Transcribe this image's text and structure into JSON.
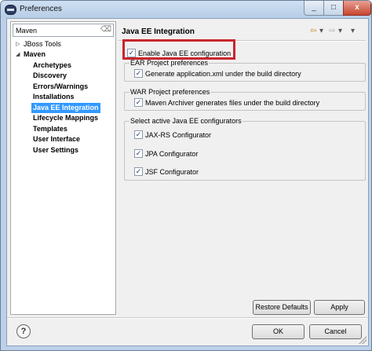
{
  "window": {
    "title": "Preferences",
    "close_glyph": "x",
    "min_glyph": "_",
    "max_glyph": "□"
  },
  "filter": {
    "value": "Maven"
  },
  "tree": [
    {
      "label": "JBoss Tools",
      "expanded": false,
      "bold": false,
      "selected": false
    },
    {
      "label": "Maven",
      "expanded": true,
      "bold": true,
      "selected": false
    },
    {
      "label": "Archetypes",
      "bold": true,
      "selected": false
    },
    {
      "label": "Discovery",
      "bold": true,
      "selected": false
    },
    {
      "label": "Errors/Warnings",
      "bold": true,
      "selected": false
    },
    {
      "label": "Installations",
      "bold": true,
      "selected": false
    },
    {
      "label": "Java EE Integration",
      "bold": true,
      "selected": true
    },
    {
      "label": "Lifecycle Mappings",
      "bold": true,
      "selected": false
    },
    {
      "label": "Templates",
      "bold": true,
      "selected": false
    },
    {
      "label": "User Interface",
      "bold": true,
      "selected": false
    },
    {
      "label": "User Settings",
      "bold": true,
      "selected": false
    }
  ],
  "page": {
    "title": "Java EE Integration",
    "nav": {
      "back_glyph": "⇦",
      "fwd_glyph": "⇨",
      "menu_glyph": "▾"
    },
    "enable": {
      "label": "Enable Java EE configuration",
      "checked": true
    },
    "ear": {
      "title": "EAR Project preferences",
      "option": {
        "label": "Generate application.xml under the build directory",
        "checked": true
      }
    },
    "war": {
      "title": "WAR Project preferences",
      "option": {
        "label": "Maven Archiver generates files under the build directory",
        "checked": true
      }
    },
    "configurators": {
      "title": "Select active Java EE configurators",
      "items": [
        {
          "label": "JAX-RS Configurator",
          "checked": true
        },
        {
          "label": "JPA Configurator",
          "checked": true
        },
        {
          "label": "JSF Configurator",
          "checked": true
        }
      ]
    }
  },
  "buttons": {
    "restore": "Restore Defaults",
    "apply": "Apply",
    "ok": "OK",
    "cancel": "Cancel"
  },
  "help": {
    "glyph": "?"
  },
  "colors": {
    "highlight": "#c9252c",
    "selection": "#3399ff"
  }
}
